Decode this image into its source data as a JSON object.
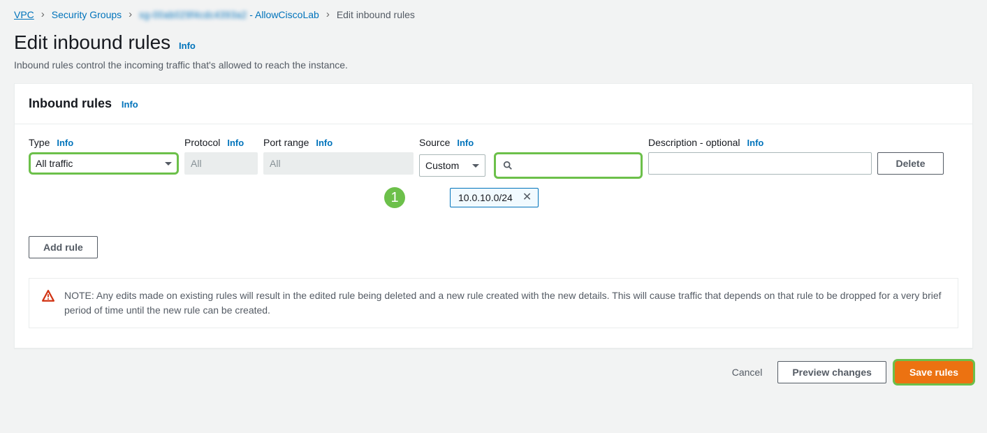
{
  "breadcrumb": {
    "items": [
      {
        "label": "VPC"
      },
      {
        "label": "Security Groups"
      },
      {
        "blurred": "sg-00ab029f4cdc4393a2",
        "suffix": " - AllowCiscoLab"
      },
      {
        "label": "Edit inbound rules"
      }
    ]
  },
  "page": {
    "title": "Edit inbound rules",
    "info": "Info",
    "subtitle": "Inbound rules control the incoming traffic that's allowed to reach the instance."
  },
  "panel": {
    "title": "Inbound rules",
    "info": "Info",
    "columns": {
      "type": "Type",
      "protocol": "Protocol",
      "port": "Port range",
      "source": "Source",
      "description": "Description - optional"
    },
    "row": {
      "type_value": "All traffic",
      "protocol_value": "All",
      "port_value": "All",
      "source_mode": "Custom",
      "source_search_value": "",
      "cidr_tag": "10.0.10.0/24",
      "description_value": "",
      "delete_label": "Delete"
    },
    "callout_number": "1",
    "add_rule_label": "Add rule",
    "note": "NOTE: Any edits made on existing rules will result in the edited rule being deleted and a new rule created with the new details. This will cause traffic that depends on that rule to be dropped for a very brief period of time until the new rule can be created."
  },
  "actions": {
    "cancel": "Cancel",
    "preview": "Preview changes",
    "save": "Save rules"
  }
}
